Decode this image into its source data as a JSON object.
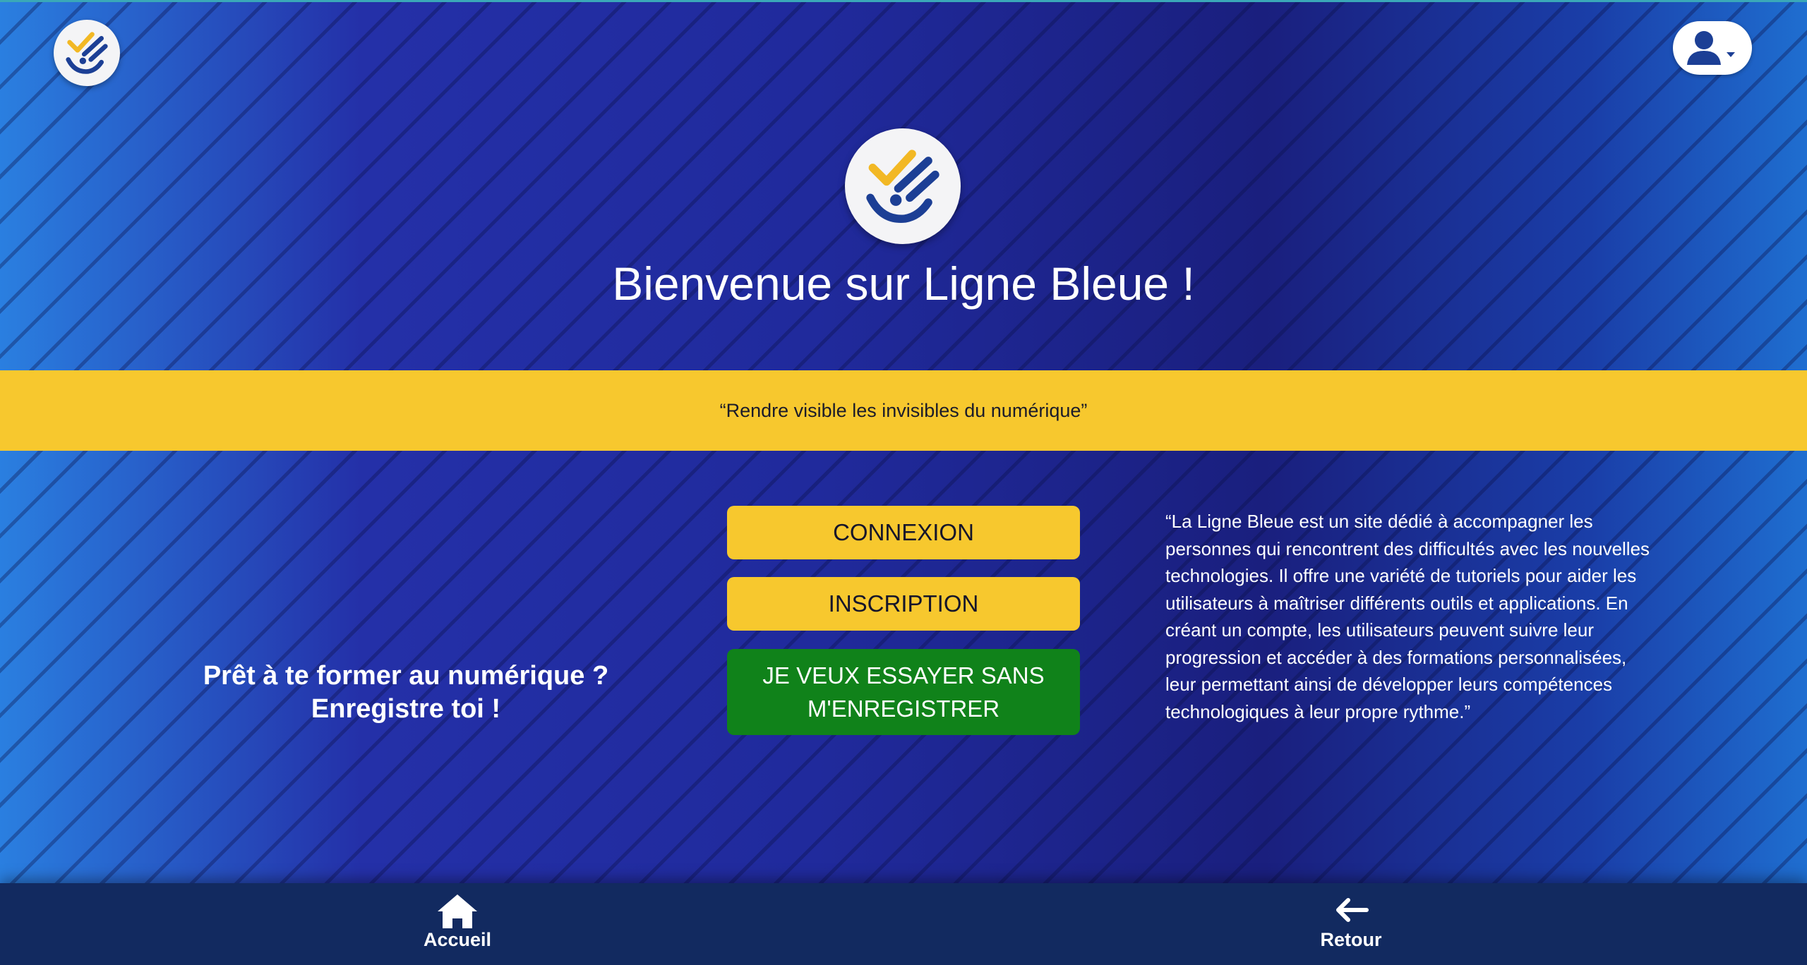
{
  "header": {
    "logo_icon": "ligne-bleue-logo",
    "profile_icon": "user-icon",
    "dropdown_icon": "caret-down-icon"
  },
  "hero": {
    "title": "Bienvenue sur Ligne Bleue !"
  },
  "banner": {
    "tagline": "“Rendre visible les invisibles du numérique”"
  },
  "cta": {
    "line1": "Prêt à te former au numérique ?",
    "line2": "Enregistre toi !"
  },
  "buttons": {
    "login": "CONNEXION",
    "signup": "INSCRIPTION",
    "try_line1": "JE VEUX ESSAYER SANS",
    "try_line2": "M'ENREGISTRER"
  },
  "description": "“La Ligne Bleue est un site dédié à accompagner les personnes qui rencontrent des difficultés avec les nouvelles technologies. Il offre une variété de tutoriels pour aider les utilisateurs à maîtriser différents outils et applications. En créant un compte, les utilisateurs peuvent suivre leur progression et accéder à des formations personnalisées, leur permettant ainsi de développer leurs compétences technologiques à leur propre rythme.”",
  "bottom_nav": {
    "home_label": "Accueil",
    "back_label": "Retour",
    "home_icon": "home-icon",
    "back_icon": "arrow-left-icon"
  },
  "colors": {
    "brand_yellow": "#f7c82e",
    "brand_blue": "#202a9c",
    "nav_dark": "#122a60",
    "green": "#10821a"
  }
}
